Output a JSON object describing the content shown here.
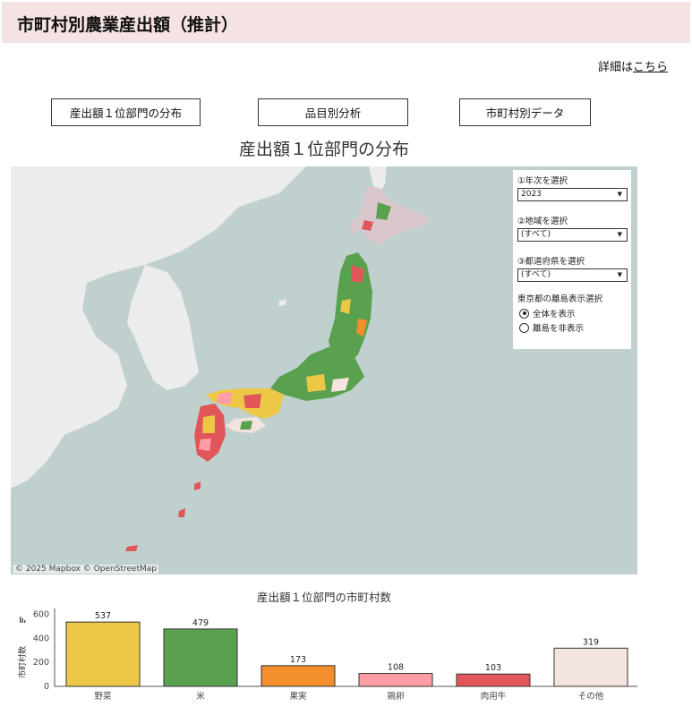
{
  "header": {
    "title": "市町村別農業産出額（推計）"
  },
  "detail": {
    "prefix": "詳細は",
    "link": "こちら"
  },
  "nav": [
    {
      "label": "産出額１位部門の分布"
    },
    {
      "label": "品目別分析"
    },
    {
      "label": "市町村別データ"
    }
  ],
  "map": {
    "title": "産出額１位部門の分布",
    "attribution": "© 2025 Mapbox  © OpenStreetMap",
    "colors": {
      "sea": "#bfd0cf",
      "land": "#ececec"
    }
  },
  "filters": {
    "year_label": "①年次を選択",
    "year_value": "2023",
    "region_label": "②地域を選択",
    "region_value": "(すべて)",
    "pref_label": "③都道府県を選択",
    "pref_value": "(すべて)",
    "island_label": "東京都の離島表示選択",
    "island_options": [
      "全体を表示",
      "離島を非表示"
    ],
    "island_selected": 0
  },
  "chart_data": {
    "type": "bar",
    "title": "産出額１位部門の市町村数",
    "ylabel": "市町村数",
    "categories": [
      "野菜",
      "米",
      "果実",
      "鶏卵",
      "肉用牛",
      "その他"
    ],
    "values": [
      537,
      479,
      173,
      108,
      103,
      319
    ],
    "colors": [
      "#ecc846",
      "#59a14f",
      "#f28e2b",
      "#ff9da7",
      "#e15759",
      "#f4e4e0"
    ],
    "yticks": [
      0,
      200,
      400,
      600
    ],
    "ylim": [
      0,
      650
    ]
  }
}
